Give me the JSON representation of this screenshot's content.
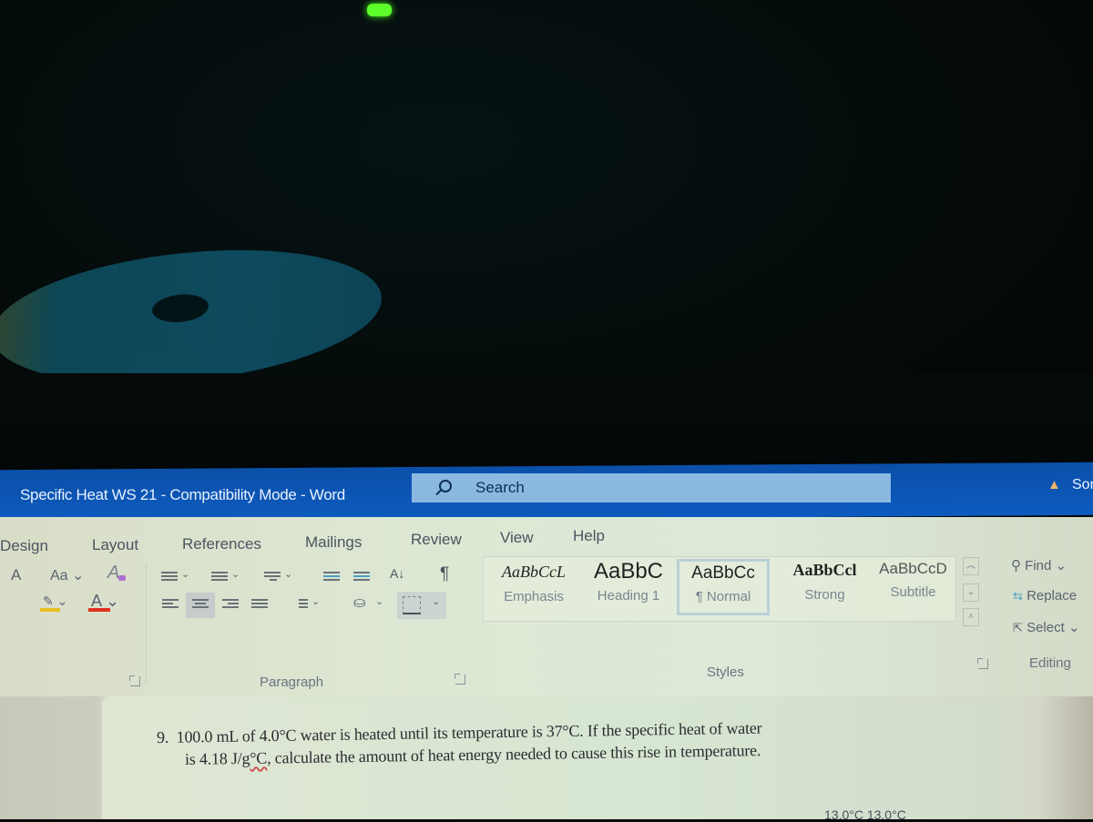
{
  "window": {
    "title": "Specific Heat WS 21  -  Compatibility Mode  -  Word",
    "search_placeholder": "Search",
    "notice_partial": "Sor"
  },
  "tabs": [
    "Design",
    "Layout",
    "References",
    "Mailings",
    "Review",
    "View",
    "Help"
  ],
  "font_group": {
    "grow_font": "A",
    "change_case": "Aa",
    "clear_formatting": "A",
    "font_color_label": "A",
    "highlight_color": "#e8c020",
    "font_color": "#e03020"
  },
  "paragraph_group": {
    "label": "Paragraph",
    "sort_icon": "A↓Z",
    "show_marks": "¶"
  },
  "styles_group": {
    "label": "Styles",
    "items": [
      {
        "sample": "AaBbCcL",
        "name": "Emphasis"
      },
      {
        "sample": "AaBbC",
        "name": "Heading 1"
      },
      {
        "sample": "AaBbCc",
        "name": "¶ Normal",
        "selected": true
      },
      {
        "sample": "AaBbCcl",
        "name": "Strong"
      },
      {
        "sample": "AaBbCcD",
        "name": "Subtitle"
      }
    ]
  },
  "editing_group": {
    "label": "Editing",
    "find": "Find",
    "replace": "Replace",
    "select": "Select"
  },
  "document": {
    "question_number": "9.",
    "line1": "100.0 mL of 4.0°C water is heated until its temperature is 37°C.  If the specific heat of water",
    "line2_prefix": "is 4.18 J/",
    "line2_squiggle": "g°C",
    "line2_suffix": ", calculate the amount of heat energy needed to cause this rise in temperature.",
    "partial_bottom": "13.0°C    13.0°C"
  }
}
